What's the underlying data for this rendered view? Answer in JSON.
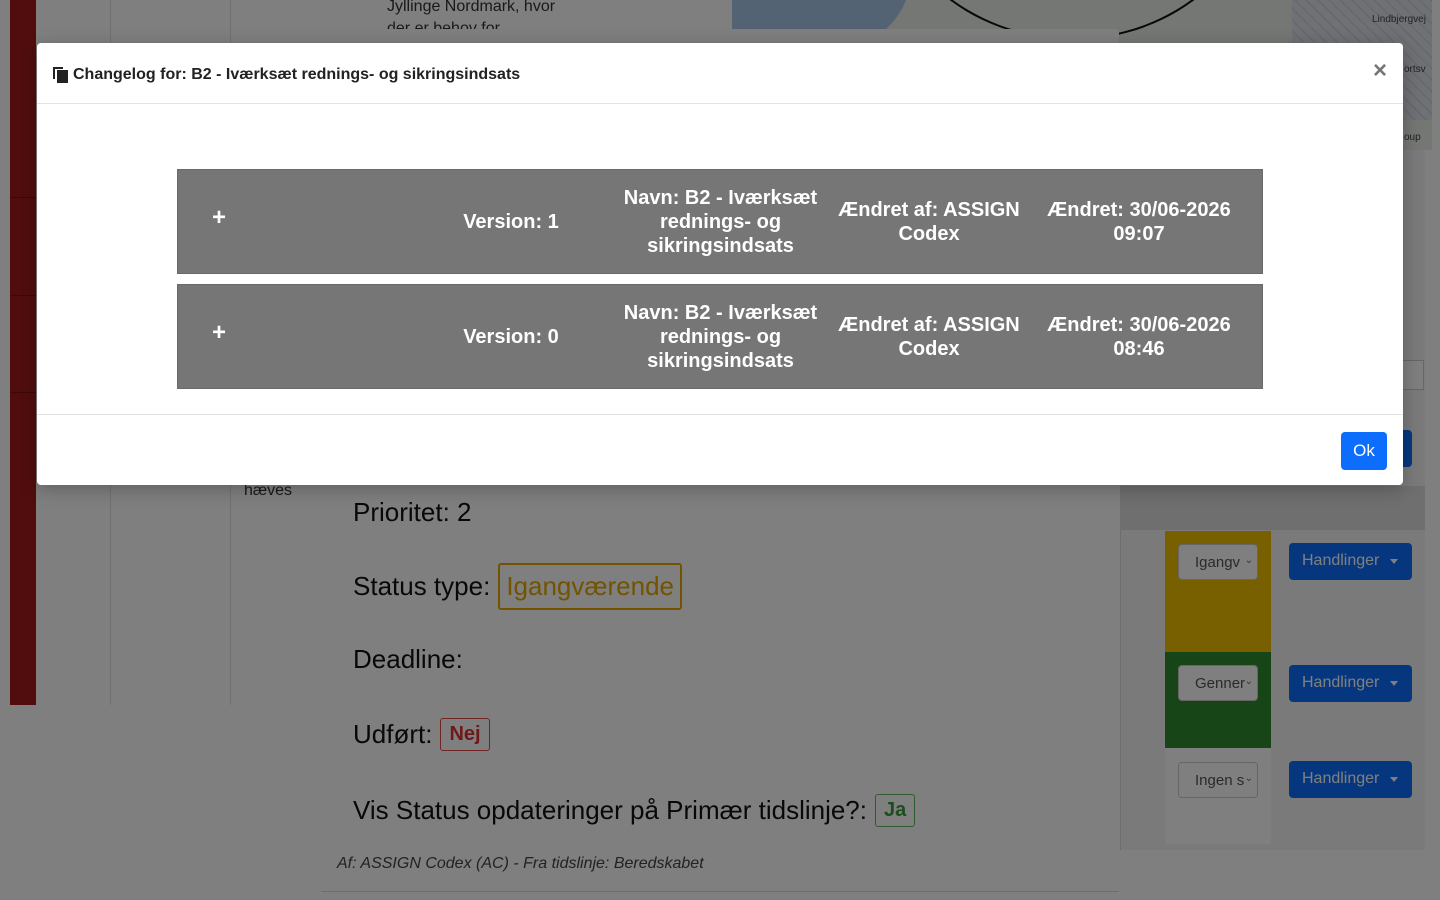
{
  "background": {
    "text_top_1": "Jyllinge Nordmark, hvor",
    "text_top_2": "der er behov for",
    "text_haeves": "hæves",
    "map_label_1": "Lindbjergvej",
    "map_label_2": "ortsv",
    "map_label_3": "oup",
    "rows": [
      {
        "select_value": "Igangv",
        "actions_label": "Handlinger",
        "status_color": "#f0c000"
      },
      {
        "select_value": "Genner",
        "actions_label": "Handlinger",
        "status_color": "#2e8b2e"
      },
      {
        "select_value": "Ingen s",
        "actions_label": "Handlinger",
        "status_color": "#ffffff"
      }
    ]
  },
  "inner_modal": {
    "priority_label": "Prioritet: 2",
    "status_type_label": "Status type:",
    "status_type_value": "Igangværende",
    "deadline_label": "Deadline:",
    "done_label": "Udført:",
    "done_value": "Nej",
    "show_status_label": "Vis Status opdateringer på Primær tidslinje?:",
    "show_status_value": "Ja",
    "author_line": "Af: ASSIGN Codex (AC) - Fra tidslinje: Beredskabet"
  },
  "changelog_modal": {
    "title": "Changelog for: B2 - Iværksæt rednings- og sikringsindsats",
    "close_symbol": "×",
    "ok_label": "Ok",
    "entries": [
      {
        "expand_symbol": "+",
        "version": "Version: 1",
        "name": "Navn: B2 - Iværksæt rednings- og sikringsindsats",
        "changed_by": "Ændret af: ASSIGN Codex",
        "changed_at": "Ændret: 30/06-2026 09:07"
      },
      {
        "expand_symbol": "+",
        "version": "Version: 0",
        "name": "Navn: B2 - Iværksæt rednings- og sikringsindsats",
        "changed_by": "Ændret af: ASSIGN Codex",
        "changed_at": "Ændret: 30/06-2026 08:46"
      }
    ]
  }
}
